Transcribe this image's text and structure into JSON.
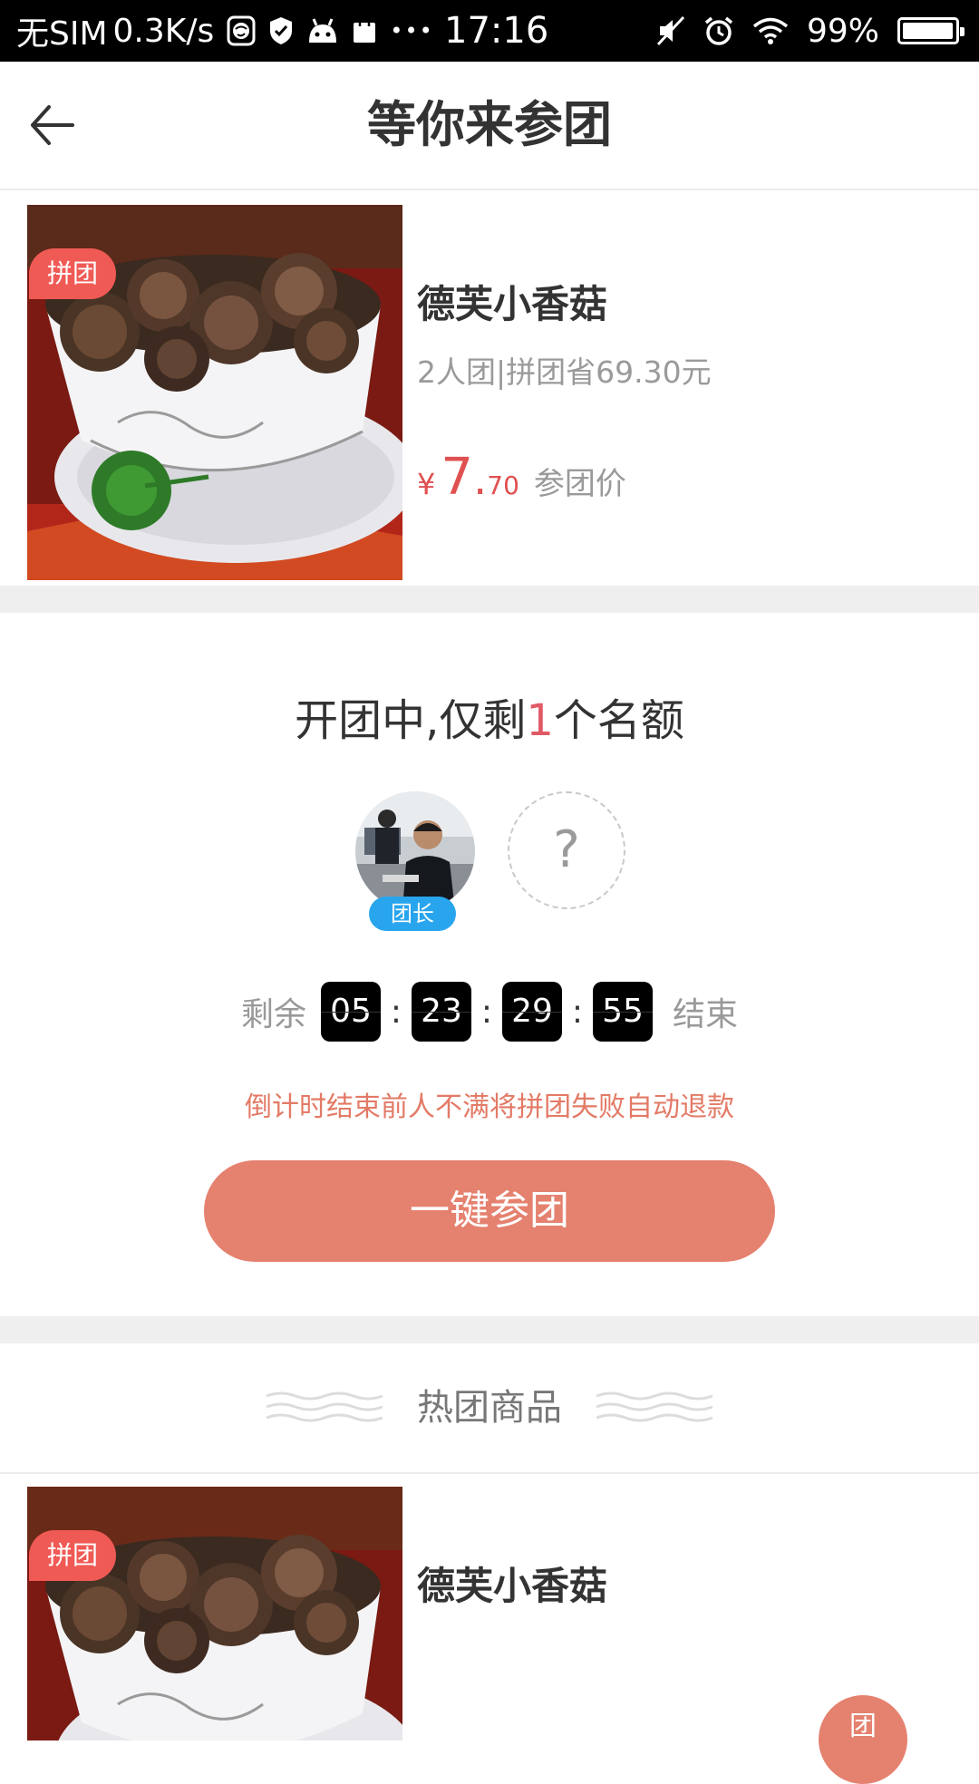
{
  "status_bar": {
    "carrier": "无SIM",
    "speed": "0.3K/s",
    "dots": "•••",
    "time": "17:16",
    "battery": "99%",
    "battery_level": 0.99
  },
  "header": {
    "title": "等你来参团"
  },
  "product": {
    "badge": "拼团",
    "name": "德芙小香菇",
    "subtitle": "2人团|拼团省69.30元",
    "price_currency": "¥",
    "price_integer": "7",
    "price_dot": ".",
    "price_decimal": "70",
    "price_label": "参团价"
  },
  "group": {
    "title_prefix": "开团中,仅剩",
    "remaining": "1",
    "title_suffix": "个名额",
    "leader_tag": "团长",
    "empty_slot_symbol": "?",
    "countdown_prefix": "剩余",
    "countdown": [
      "05",
      "23",
      "29",
      "55"
    ],
    "countdown_separator": ":",
    "countdown_suffix": "结束",
    "refund_note": "倒计时结束前人不满将拼团失败自动退款",
    "join_button": "一键参团"
  },
  "hot": {
    "title": "热团商品",
    "item": {
      "badge": "拼团",
      "name": "德芙小香菇"
    },
    "float_button": "团"
  },
  "colors": {
    "price_red": "#e05050",
    "badge_red": "#f05a55",
    "button_salmon": "#e5816f",
    "leader_blue": "#29a5ee",
    "note_orange": "#e37a66",
    "band_gray": "#efefef"
  }
}
